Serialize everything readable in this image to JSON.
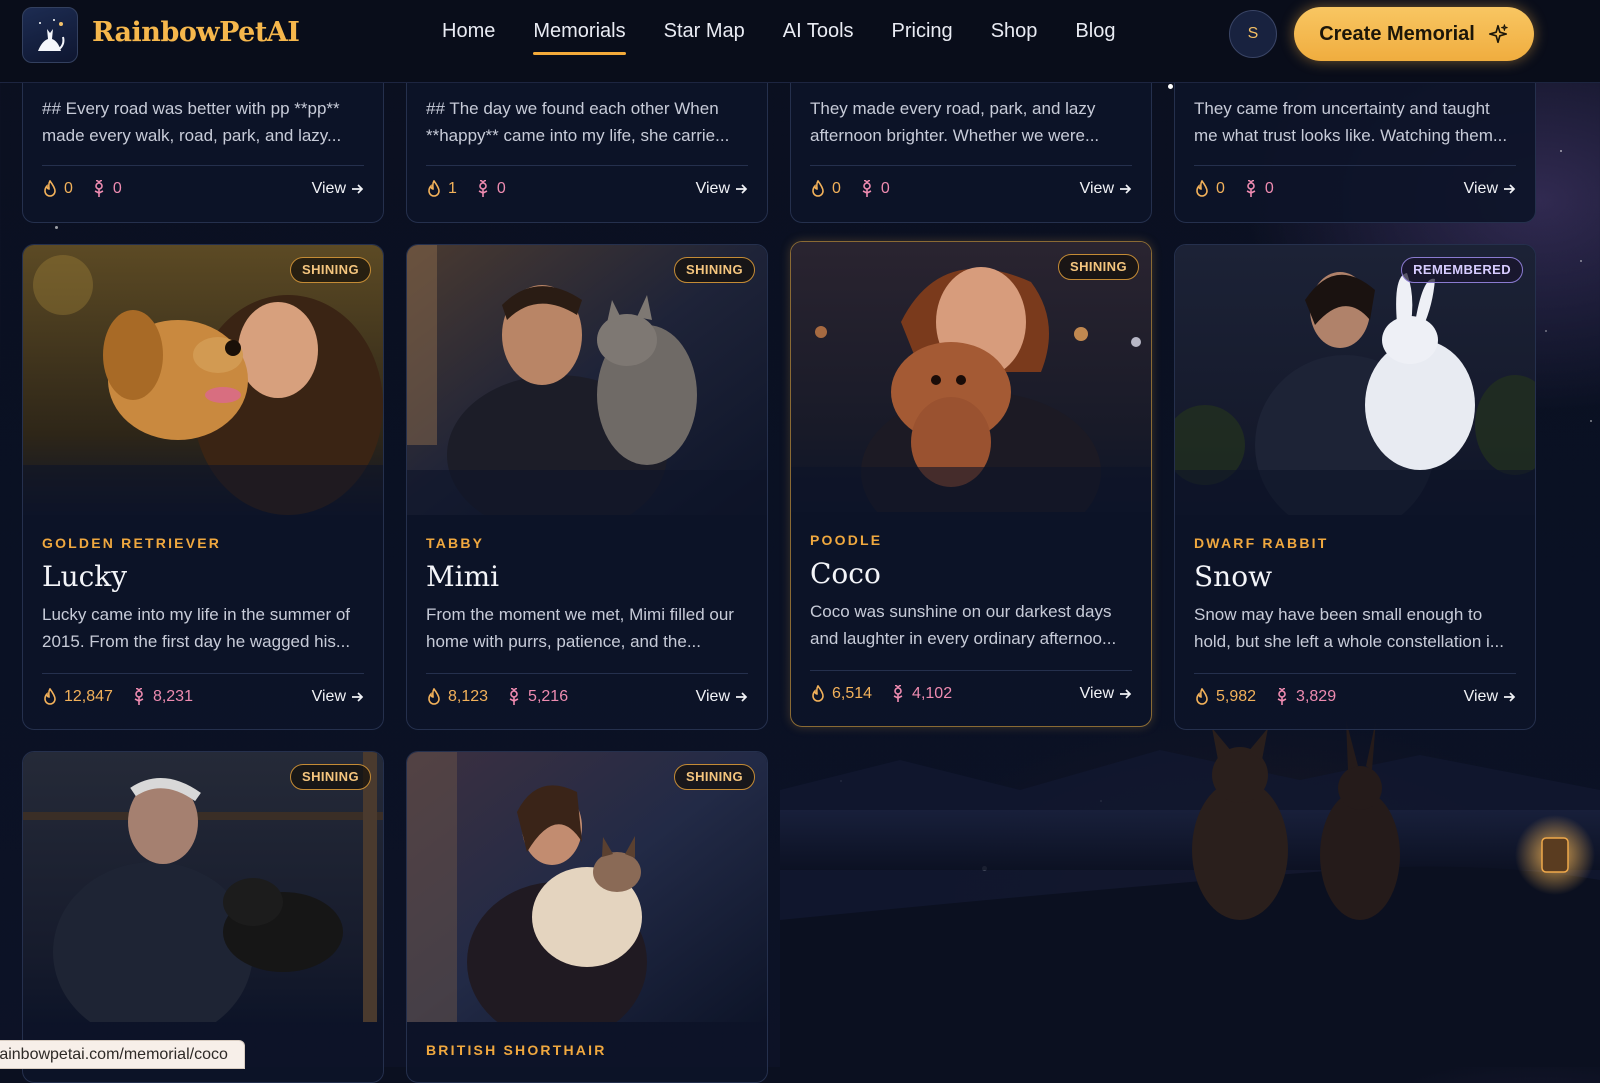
{
  "brand": {
    "name": "RainbowPetAI",
    "logo_icon": "cat-silhouette-icon"
  },
  "nav": {
    "items": [
      {
        "label": "Home",
        "active": false
      },
      {
        "label": "Memorials",
        "active": true
      },
      {
        "label": "Star Map",
        "active": false
      },
      {
        "label": "AI Tools",
        "active": false
      },
      {
        "label": "Pricing",
        "active": false
      },
      {
        "label": "Shop",
        "active": false
      },
      {
        "label": "Blog",
        "active": false
      }
    ]
  },
  "user": {
    "avatar_initial": "S"
  },
  "cta": {
    "label": "Create Memorial",
    "icon": "sparkle-icon"
  },
  "top_row": [
    {
      "excerpt": "## Every road was better with pp **pp** made every walk, road, park, and lazy...",
      "candles": "0",
      "flowers": "0",
      "view": "View"
    },
    {
      "excerpt": "## The day we found each other When **happy** came into my life, she carrie...",
      "candles": "1",
      "flowers": "0",
      "view": "View"
    },
    {
      "excerpt": "They made every road, park, and lazy afternoon brighter. Whether we were...",
      "candles": "0",
      "flowers": "0",
      "view": "View"
    },
    {
      "excerpt": "They came from uncertainty and taught me what trust looks like. Watching them...",
      "candles": "0",
      "flowers": "0",
      "view": "View"
    }
  ],
  "middle_row": [
    {
      "badge": "SHINING",
      "breed": "GOLDEN RETRIEVER",
      "name": "Lucky",
      "excerpt": "Lucky came into my life in the summer of 2015. From the first day he wagged his...",
      "candles": "12,847",
      "flowers": "8,231",
      "view": "View"
    },
    {
      "badge": "SHINING",
      "breed": "TABBY",
      "name": "Mimi",
      "excerpt": "From the moment we met, Mimi filled our home with purrs, patience, and the...",
      "candles": "8,123",
      "flowers": "5,216",
      "view": "View"
    },
    {
      "badge": "SHINING",
      "breed": "POODLE",
      "name": "Coco",
      "excerpt": "Coco was sunshine on our darkest days and laughter in every ordinary afternoo...",
      "candles": "6,514",
      "flowers": "4,102",
      "view": "View"
    },
    {
      "badge": "REMEMBERED",
      "breed": "DWARF RABBIT",
      "name": "Snow",
      "excerpt": "Snow may have been small enough to hold, but she left a whole constellation i...",
      "candles": "5,982",
      "flowers": "3,829",
      "view": "View"
    }
  ],
  "bottom_row": [
    {
      "badge": "SHINING",
      "breed": ""
    },
    {
      "badge": "SHINING",
      "breed": "BRITISH SHORTHAIR"
    }
  ],
  "status_bar": {
    "url": "rainbowpetai.com/memorial/coco"
  },
  "colors": {
    "accent": "#f3aa3a",
    "candle": "#f2b15a",
    "flower": "#ee8bb0",
    "bg": "#0b1020"
  }
}
